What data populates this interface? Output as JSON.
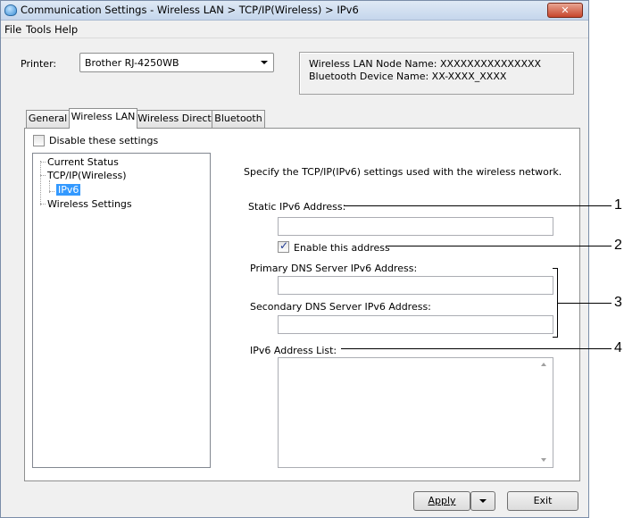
{
  "window": {
    "title": "Communication Settings - Wireless LAN > TCP/IP(Wireless) > IPv6",
    "close_label": "✕"
  },
  "menu": [
    "File",
    "Tools",
    "Help"
  ],
  "printer": {
    "label": "Printer:",
    "value": "Brother RJ-4250WB"
  },
  "info": {
    "node_name": "Wireless LAN Node Name: XXXXXXXXXXXXXXX",
    "device_name": "Bluetooth Device Name: XX-XXXX_XXXX"
  },
  "tabs": [
    {
      "label": "General",
      "active": false
    },
    {
      "label": "Wireless LAN",
      "active": true
    },
    {
      "label": "Wireless Direct",
      "active": false
    },
    {
      "label": "Bluetooth",
      "active": false
    }
  ],
  "disable_settings": {
    "label": "Disable these settings",
    "checked": false
  },
  "tree": {
    "items": [
      "Current Status",
      "TCP/IP(Wireless)",
      "IPv6",
      "Wireless Settings"
    ],
    "selected": "IPv6"
  },
  "panel": {
    "description": "Specify the TCP/IP(IPv6) settings used with the wireless network.",
    "static_label": "Static IPv6 Address:",
    "static_value": "",
    "enable_label": "Enable this address",
    "enable_checked": true,
    "primary_dns_label": "Primary DNS Server IPv6 Address:",
    "primary_dns_value": "",
    "secondary_dns_label": "Secondary DNS Server IPv6 Address:",
    "secondary_dns_value": "",
    "address_list_label": "IPv6 Address List:"
  },
  "buttons": {
    "apply": "Apply",
    "exit": "Exit"
  },
  "callouts": [
    "1",
    "2",
    "3",
    "4"
  ]
}
